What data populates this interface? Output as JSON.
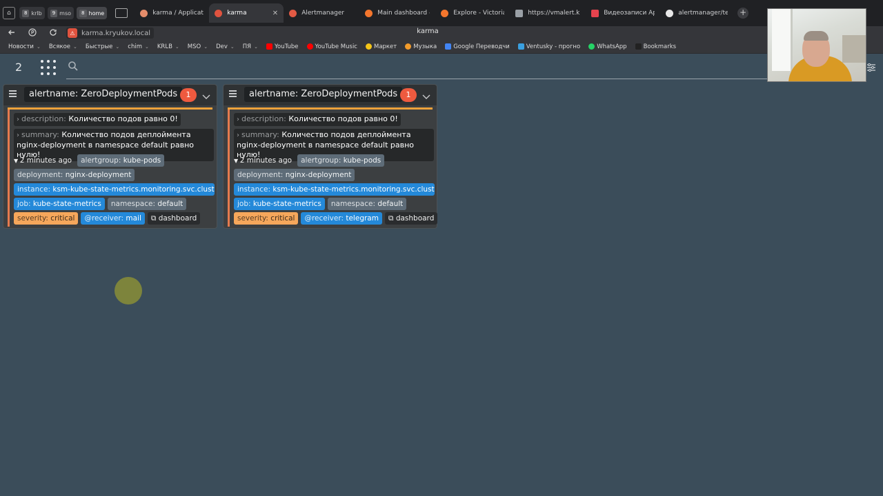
{
  "browser": {
    "workspaces": [
      {
        "num": "6",
        "label": ""
      },
      {
        "num": "8",
        "label": "krlb"
      },
      {
        "num": "9",
        "label": "mso"
      },
      {
        "num": "8",
        "label": "home"
      }
    ],
    "tabs": [
      {
        "label": "karma / Application",
        "color": "#e58d6b"
      },
      {
        "label": "karma",
        "color": "#e0533f",
        "close": "✕"
      },
      {
        "label": "Alertmanager",
        "color": "#e25a44"
      },
      {
        "label": "Main dashboard - G",
        "color": "#f4762d"
      },
      {
        "label": "Explore - Victoria - C",
        "color": "#f4762d"
      },
      {
        "label": "https://vmalert.kryuk",
        "color": "#9aa0a6"
      },
      {
        "label": "Видеозаписи Артур",
        "color": "#e6434e"
      },
      {
        "label": "alertmanager/templ",
        "color": "#e8e8e8"
      }
    ],
    "url": "karma.kryukov.local",
    "page_title": "karma",
    "bookmarks": [
      {
        "label": "Новости",
        "folder": true
      },
      {
        "label": "Всякое",
        "folder": true
      },
      {
        "label": "Быстрые",
        "folder": true
      },
      {
        "label": "chim",
        "folder": true
      },
      {
        "label": "KRLB",
        "folder": true
      },
      {
        "label": "MSO",
        "folder": true
      },
      {
        "label": "Dev",
        "folder": true
      },
      {
        "label": "ПЯ",
        "folder": true
      },
      {
        "label": "YouTube",
        "color": "#ff0000"
      },
      {
        "label": "YouTube Music",
        "color": "#ff0000"
      },
      {
        "label": "Маркет",
        "color": "#f5c518"
      },
      {
        "label": "Музыка",
        "color": "#f29b2b"
      },
      {
        "label": "Google Переводчи",
        "color": "#4285f4"
      },
      {
        "label": "Ventusky - прогно",
        "color": "#3aa0e0"
      },
      {
        "label": "WhatsApp",
        "color": "#25d366"
      },
      {
        "label": "Bookmarks",
        "color": "#222222"
      }
    ]
  },
  "karma": {
    "alert_count": "2"
  },
  "groups": [
    {
      "name_key": "alertname:",
      "name_value": "ZeroDeploymentPods",
      "badge": "1",
      "description_key": "description:",
      "description_value": "Количество подов равно 0!",
      "summary_key": "summary:",
      "summary_value": "Количество подов деплоймента nginx-deployment в namespace default равно нулю!",
      "time": "2 minutes ago",
      "labels": {
        "alertgroup": {
          "k": "alertgroup:",
          "v": "kube-pods"
        },
        "deployment": {
          "k": "deployment:",
          "v": "nginx-deployment"
        },
        "instance": {
          "k": "instance:",
          "v": "ksm-kube-state-metrics.monitoring.svc.cluster.lo..."
        },
        "job": {
          "k": "job:",
          "v": "kube-state-metrics"
        },
        "namespace": {
          "k": "namespace:",
          "v": "default"
        },
        "severity": {
          "k": "severity:",
          "v": "critical"
        },
        "receiver": {
          "k": "@receiver:",
          "v": "mail"
        }
      },
      "link": "dashboard"
    },
    {
      "name_key": "alertname:",
      "name_value": "ZeroDeploymentPods",
      "badge": "1",
      "description_key": "description:",
      "description_value": "Количество подов равно 0!",
      "summary_key": "summary:",
      "summary_value": "Количество подов деплоймента nginx-deployment в namespace default равно нулю!",
      "time": "2 minutes ago",
      "labels": {
        "alertgroup": {
          "k": "alertgroup:",
          "v": "kube-pods"
        },
        "deployment": {
          "k": "deployment:",
          "v": "nginx-deployment"
        },
        "instance": {
          "k": "instance:",
          "v": "ksm-kube-state-metrics.monitoring.svc.cluster.lo..."
        },
        "job": {
          "k": "job:",
          "v": "kube-state-metrics"
        },
        "namespace": {
          "k": "namespace:",
          "v": "default"
        },
        "severity": {
          "k": "severity:",
          "v": "critical"
        },
        "receiver": {
          "k": "@receiver:",
          "v": "telegram"
        }
      },
      "link": "dashboard"
    }
  ],
  "colors": {
    "background": "#3b4d5a",
    "badge": "#ee5a3f",
    "label_blue": "#2489d9",
    "label_grey": "#5e6c78",
    "label_orange": "#f6a75b",
    "strip": "#f0a23b"
  }
}
